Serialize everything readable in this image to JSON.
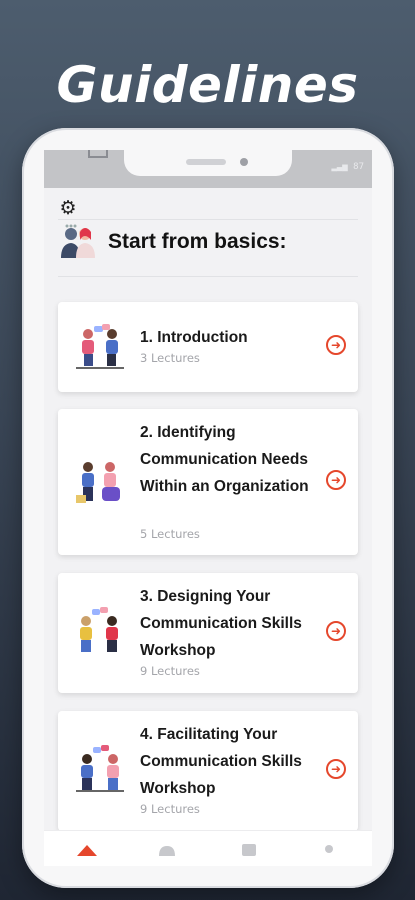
{
  "headline": "Guidelines",
  "status": {
    "battery": "87"
  },
  "section": {
    "title": "Start from basics:"
  },
  "courses": [
    {
      "title": "1. Introduction",
      "lectures": "3 Lectures"
    },
    {
      "title": "2. Identifying Communication Needs Within an Organization",
      "lectures": "5 Lectures"
    },
    {
      "title": "3. Designing Your Communication Skills Workshop",
      "lectures": "9 Lectures"
    },
    {
      "title": "4. Facilitating Your Communication Skills Workshop",
      "lectures": "9 Lectures"
    }
  ],
  "icons": {
    "settings": "gear-icon",
    "course_open": "arrow-circle-right-icon",
    "nav": [
      "home-icon",
      "courses-icon",
      "library-icon",
      "profile-icon"
    ]
  },
  "colors": {
    "accent": "#e5472c",
    "background": "#3a4656",
    "nav_active": "#e5472c",
    "nav_inactive": "#c7c8cc"
  }
}
